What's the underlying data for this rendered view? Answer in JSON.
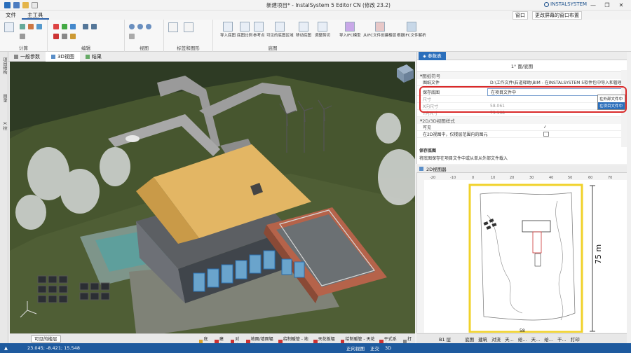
{
  "window": {
    "title": "新建项目* - InstalSystem 5 Editor CN (修改 23.2)",
    "brand": "INSTALSYSTEM",
    "controls": [
      "—",
      "❐",
      "✕"
    ]
  },
  "menu": {
    "tabs": [
      "文件",
      "主工具"
    ],
    "active": "主工具",
    "right_buttons": [
      "窗口",
      "更改屏幕的窗口布置"
    ]
  },
  "ribbon": {
    "groups": [
      "计算",
      "编辑",
      "视图",
      "标签和图形",
      "底图"
    ],
    "underlay_buttons": [
      "导入底图",
      "底图比例",
      "参考点",
      "可见的底图区域",
      "移动底图",
      "调整剪切",
      "导入IFC模型",
      "从IFC文件创建楼层",
      "根据IFC文件解析"
    ]
  },
  "left_strip": [
    "项目结构",
    "目录",
    "X 控"
  ],
  "doc_tabs": [
    "一般参数",
    "3D视图",
    "结果"
  ],
  "doc_tab_active": "3D视图",
  "viewport_footer": {
    "dropdown": "可见的楼层",
    "layers": [
      "底图",
      "建筑",
      "对流",
      "地面/墙面辐射",
      "给制暖管 - 地面",
      "天花板辐射",
      "给制暖管 - 天花板",
      "干式系统",
      "打印"
    ]
  },
  "properties": {
    "tab_label": "参数表",
    "title": "1° 面/底图",
    "sections": {
      "s1": "图纸符号",
      "s2": "2D/3D视图样式"
    },
    "rows": [
      {
        "key": "图纸文件",
        "value": "D:\\工作文件\\石道释助\\BIM - 在INSTALSYSTEM 5软件包中导入和管理"
      },
      {
        "key": "保存底图",
        "value": "在项目文件中"
      },
      {
        "key": "尺寸",
        "value": ""
      },
      {
        "key": "X向尺寸",
        "value": "58.061"
      },
      {
        "key": "Y向尺寸",
        "value": "75.168"
      }
    ],
    "rows2": [
      {
        "key": "可见",
        "value": "✓"
      },
      {
        "key": "在2D视图中，仅楼层范围内的图元",
        "value": ""
      }
    ],
    "dropdown_options": [
      "在外部文件中",
      "在项目文件中"
    ],
    "dropdown_selected": "在项目文件中",
    "help_title": "保存底图",
    "help_text": "将底图保存在项目文件中或从单从外部文件载入"
  },
  "nav": {
    "title": "2D视图器",
    "dimension": "75 m",
    "dimension_top": "58",
    "ruler": [
      "-20",
      "-10",
      "0",
      "10",
      "20",
      "30",
      "40",
      "50",
      "60",
      "70"
    ]
  },
  "nav_footer": {
    "level": "B1 层",
    "layers": [
      "底图",
      "建筑",
      "对流",
      "天...",
      "给...",
      "天...",
      "给...",
      "干...",
      "打印"
    ]
  },
  "status": {
    "coords": "23.045; -8.421; 15.548",
    "right": [
      "正向视图",
      "正交",
      "3D"
    ]
  }
}
